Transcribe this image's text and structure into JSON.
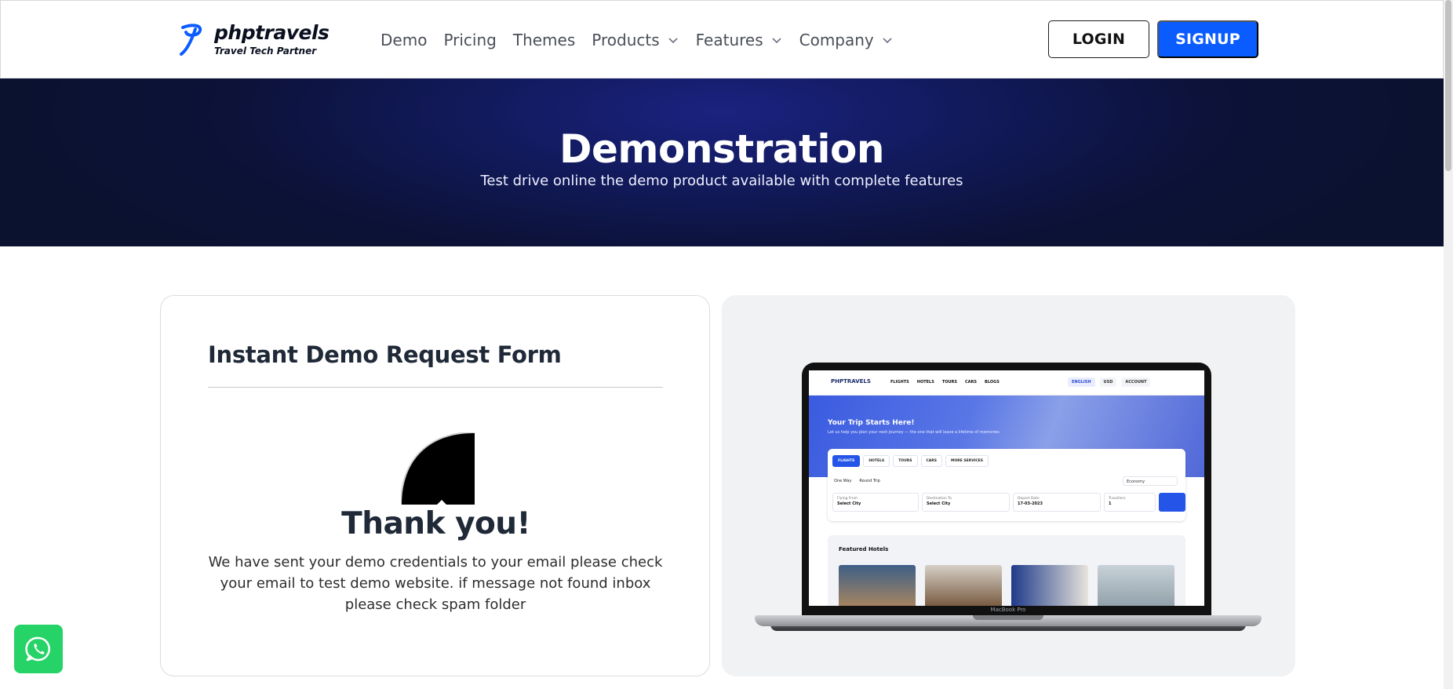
{
  "brand": {
    "name": "phptravels",
    "tagline": "Travel Tech Partner",
    "color": "#0b5cff"
  },
  "nav": {
    "items": [
      {
        "label": "Demo",
        "has_dropdown": false
      },
      {
        "label": "Pricing",
        "has_dropdown": false
      },
      {
        "label": "Themes",
        "has_dropdown": false
      },
      {
        "label": "Products",
        "has_dropdown": true
      },
      {
        "label": "Features",
        "has_dropdown": true
      },
      {
        "label": "Company",
        "has_dropdown": true
      }
    ],
    "login_label": "LOGIN",
    "signup_label": "SIGNUP"
  },
  "hero": {
    "title": "Demonstration",
    "subtitle": "Test drive online the demo product available with complete features"
  },
  "form": {
    "title": "Instant Demo Request Form",
    "thank_title": "Thank you!",
    "thank_message": "We have sent your demo credentials to your email please check your email to test demo website. if message not found inbox please check spam folder"
  },
  "preview": {
    "laptop_model": "MacBook Pro",
    "site": {
      "logo": "PHPTRAVELS",
      "links": [
        "FLIGHTS",
        "HOTELS",
        "TOURS",
        "CARS",
        "BLOGS"
      ],
      "lang": "ENGLISH",
      "currency": "USD",
      "account": "ACCOUNT",
      "hero_title": "Your Trip Starts Here!",
      "hero_subtitle": "Let us help you plan your next journey — the one that will leave a lifetime of memories",
      "tabs": [
        "FLIGHTS",
        "HOTELS",
        "TOURS",
        "CARS",
        "MORE SERVICES"
      ],
      "trip_types": [
        "One Way",
        "Round Trip"
      ],
      "cabin_class": "Economy",
      "fields": [
        {
          "label": "Flying From",
          "value": "Select City"
        },
        {
          "label": "Destination To",
          "value": "Select City"
        },
        {
          "label": "Depart Date",
          "value": "17-03-2023"
        },
        {
          "label": "Travellers",
          "value": "1"
        }
      ],
      "featured_title": "Featured Hotels"
    }
  },
  "whatsapp": {
    "icon": "whatsapp-icon",
    "color": "#25d366"
  }
}
